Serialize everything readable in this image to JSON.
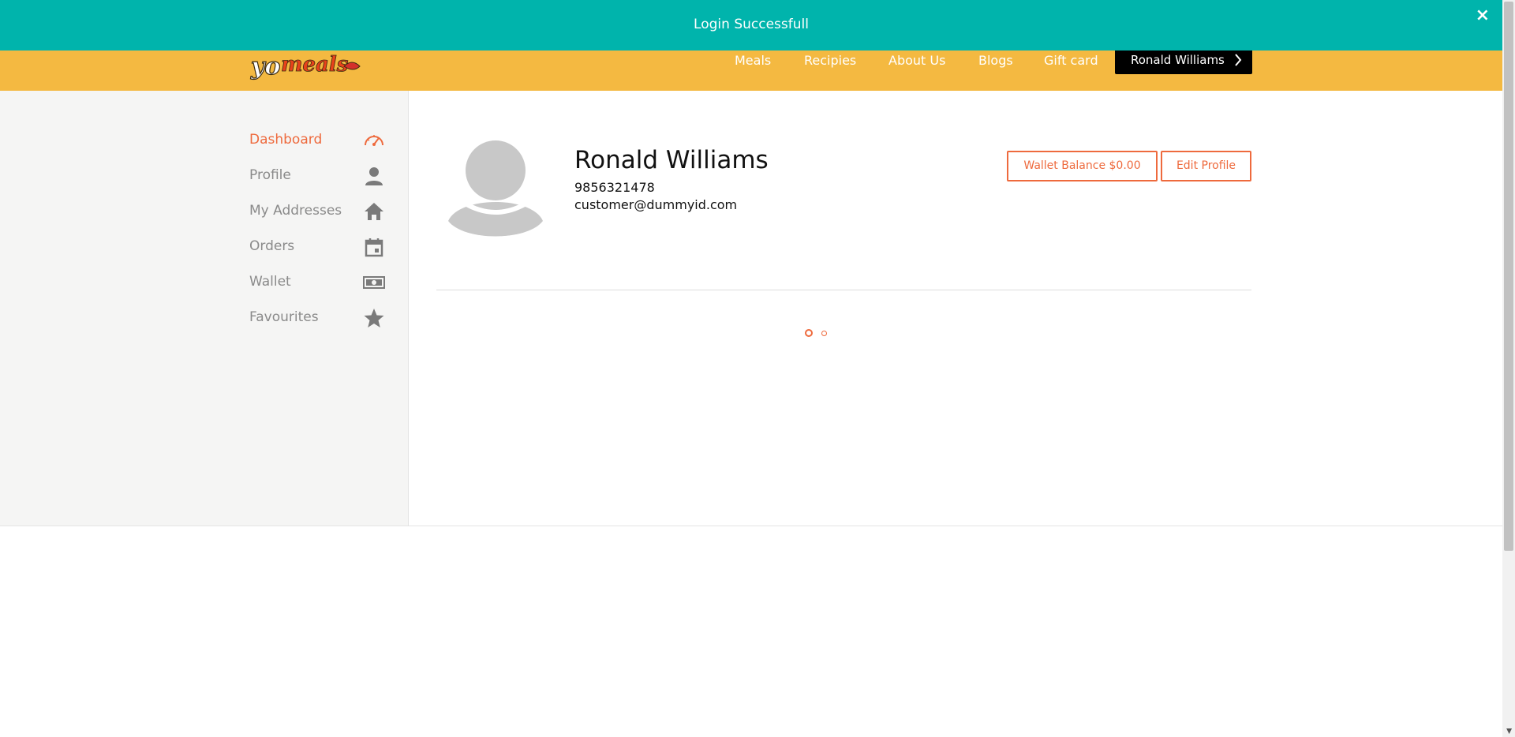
{
  "notification": {
    "message": "Login Successfull",
    "close_label": "×"
  },
  "header": {
    "logo_text": "yomeals",
    "nav": [
      {
        "label": "Meals"
      },
      {
        "label": "Recipies"
      },
      {
        "label": "About Us"
      },
      {
        "label": "Blogs"
      },
      {
        "label": "Gift card"
      }
    ],
    "user_button": "Ronald Williams",
    "user_button_icon": "chevron-right-icon"
  },
  "sidebar": {
    "items": [
      {
        "label": "Dashboard",
        "icon": "speedometer-icon",
        "active": true
      },
      {
        "label": "Profile",
        "icon": "user-icon",
        "active": false
      },
      {
        "label": "My Addresses",
        "icon": "home-icon",
        "active": false
      },
      {
        "label": "Orders",
        "icon": "calendar-icon",
        "active": false
      },
      {
        "label": "Wallet",
        "icon": "money-icon",
        "active": false
      },
      {
        "label": "Favourites",
        "icon": "star-icon",
        "active": false
      }
    ]
  },
  "profile": {
    "name": "Ronald Williams",
    "phone": "9856321478",
    "email": "customer@dummyid.com",
    "wallet_button": "Wallet Balance $0.00",
    "edit_button": "Edit Profile"
  },
  "colors": {
    "header": "#f4b941",
    "notification": "#00b4ac",
    "accent": "#ee6a3d",
    "sidebar_bg": "#f5f5f4",
    "avatar": "#c8c8c8"
  }
}
